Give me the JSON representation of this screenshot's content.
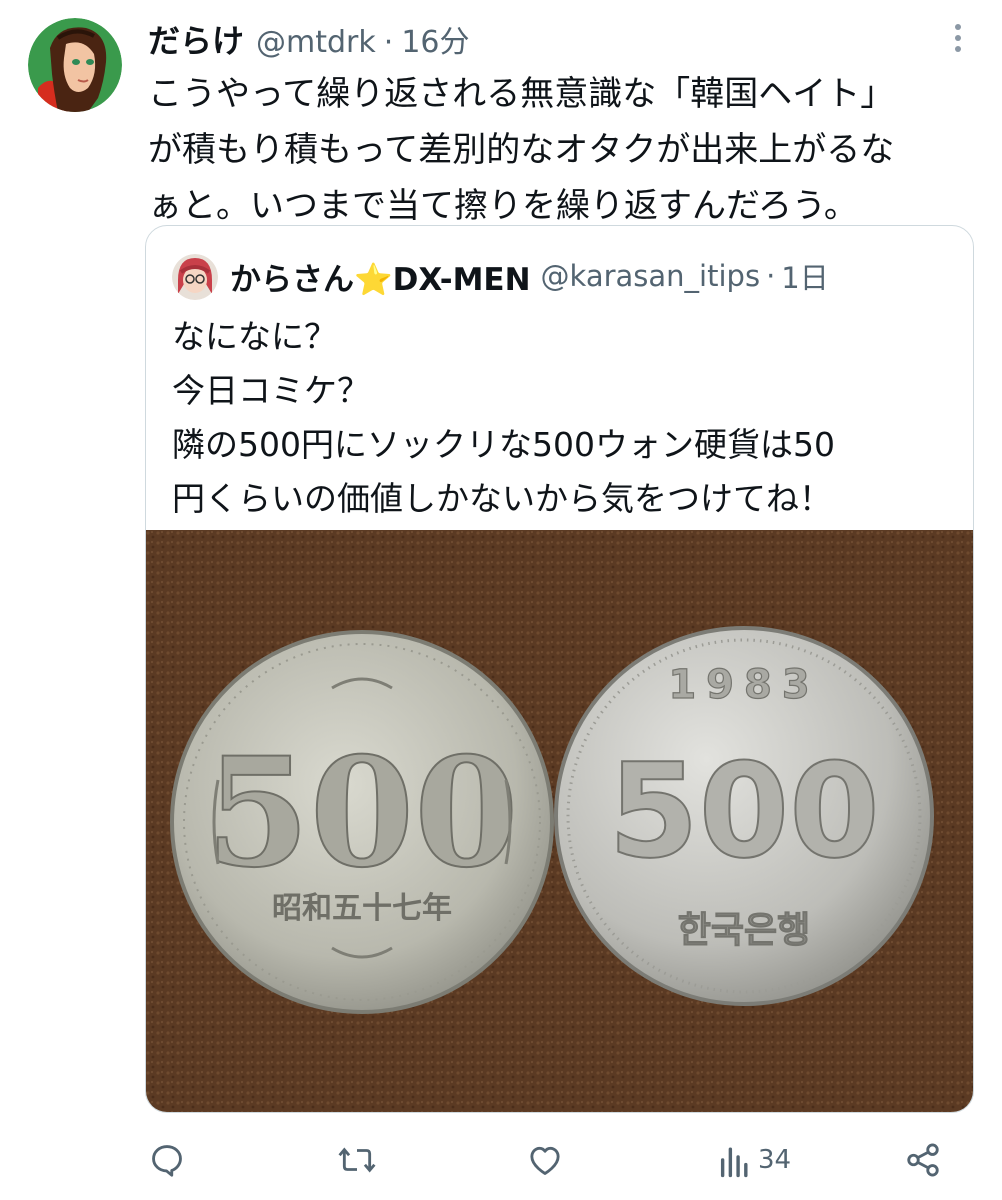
{
  "tweet": {
    "author_name": "だらけ",
    "author_handle": "@mtdrk",
    "separator": "·",
    "time": "16分",
    "text": "こうやって繰り返される無意識な「韓国ヘイト」\nが積もり積もって差別的なオタクが出来上がるな\nぁと。いつまで当て擦りを繰り返すんだろう。"
  },
  "quote": {
    "author_name": "からさん⭐DX-MEN",
    "author_handle": "@karasan_itips",
    "separator": "·",
    "time": "1日",
    "text": "なになに？\n今日コミケ？\n隣の500円にソックリな500ウォン硬貨は50\n円くらいの価値しかないから気をつけてね！",
    "photo": {
      "left_coin": {
        "value_text": "500",
        "era_text": "昭和五十七年"
      },
      "right_coin": {
        "year_text": "1983",
        "value_text": "500",
        "country_text": "한국은행"
      }
    }
  },
  "actions": {
    "reply_icon": "reply-icon",
    "retweet_icon": "retweet-icon",
    "like_icon": "like-icon",
    "views_icon": "views-icon",
    "views_count": "34",
    "share_icon": "share-icon"
  },
  "colors": {
    "text": "#0f1419",
    "secondary": "#536471",
    "border": "#cfd9de",
    "star": "#f5b800"
  }
}
